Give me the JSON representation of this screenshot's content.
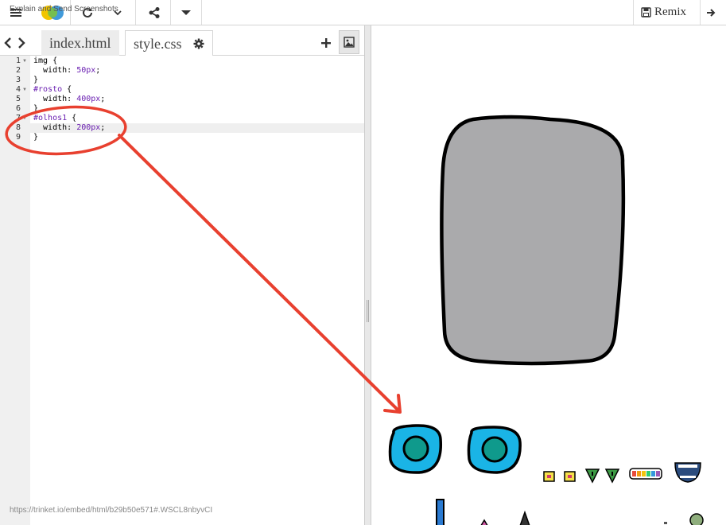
{
  "window": {
    "overlay_title": "Explain and Send Screenshots"
  },
  "toolbar": {
    "remix_label": "Remix"
  },
  "tabs": [
    {
      "label": "index.html",
      "active": false
    },
    {
      "label": "style.css",
      "active": true
    }
  ],
  "code": {
    "lines": [
      {
        "num": "1",
        "fold": true,
        "parts": [
          {
            "t": "img {",
            "c": "sel"
          }
        ]
      },
      {
        "num": "2",
        "fold": false,
        "parts": [
          {
            "t": "  width: ",
            "c": "prop"
          },
          {
            "t": "50px",
            "c": "val"
          },
          {
            "t": ";",
            "c": "prop"
          }
        ]
      },
      {
        "num": "3",
        "fold": false,
        "parts": [
          {
            "t": "}",
            "c": "sel"
          }
        ]
      },
      {
        "num": "4",
        "fold": true,
        "parts": [
          {
            "t": "#rosto",
            "c": "id-sel"
          },
          {
            "t": " {",
            "c": "sel"
          }
        ]
      },
      {
        "num": "5",
        "fold": false,
        "parts": [
          {
            "t": "  width: ",
            "c": "prop"
          },
          {
            "t": "400px",
            "c": "val"
          },
          {
            "t": ";",
            "c": "prop"
          }
        ]
      },
      {
        "num": "6",
        "fold": false,
        "parts": [
          {
            "t": "}",
            "c": "sel"
          }
        ]
      },
      {
        "num": "7",
        "fold": true,
        "parts": [
          {
            "t": "#olhos1",
            "c": "id-sel"
          },
          {
            "t": " {",
            "c": "sel"
          }
        ]
      },
      {
        "num": "8",
        "fold": false,
        "parts": [
          {
            "t": "  width: ",
            "c": "prop"
          },
          {
            "t": "200px",
            "c": "val"
          },
          {
            "t": ";",
            "c": "prop"
          }
        ],
        "highlight": true
      },
      {
        "num": "9",
        "fold": false,
        "parts": [
          {
            "t": "}",
            "c": "sel"
          }
        ]
      }
    ]
  },
  "status": {
    "url_overlay": "https://trinket.io/embed/html/b29b50e571#.WSCL8nbyvCI"
  },
  "colors": {
    "accent_annotation": "#e8402f",
    "face_fill": "#aaaaac",
    "eye_outer": "#1ab4e6",
    "eye_inner": "#0f9a8c",
    "value_purple": "#6a1fb1"
  }
}
